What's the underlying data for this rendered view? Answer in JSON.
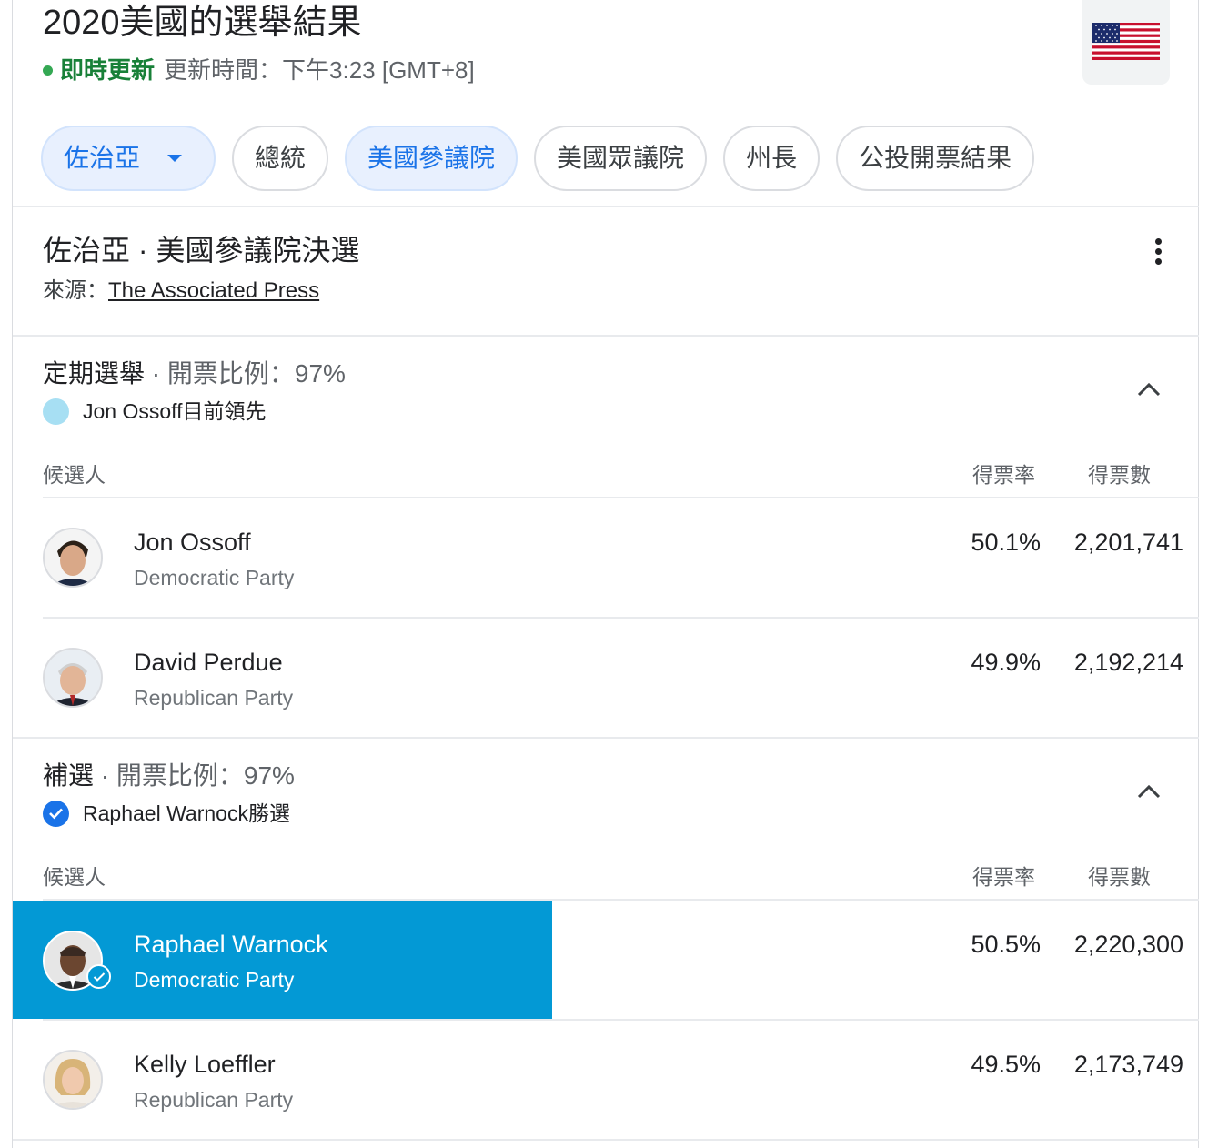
{
  "header": {
    "title": "2020美國的選舉結果",
    "live_label": "即時更新",
    "update_time": "更新時間：下午3:23 [GMT+8]",
    "flag_icon": "us-flag-icon"
  },
  "tabs": [
    {
      "label": "佐治亞",
      "selected": true,
      "dropdown": true
    },
    {
      "label": "總統",
      "selected": false
    },
    {
      "label": "美國參議院",
      "selected": true
    },
    {
      "label": "美國眾議院",
      "selected": false
    },
    {
      "label": "州長",
      "selected": false
    },
    {
      "label": "公投開票結果",
      "selected": false
    }
  ],
  "race": {
    "title": "佐治亞 · 美國參議院決選",
    "source_label": "來源：",
    "source_link": "The Associated Press"
  },
  "sections": [
    {
      "title": "定期選舉",
      "sep": " · ",
      "reporting": "開票比例：97%",
      "status": "Jon Ossoff目前領先",
      "status_icon": "lead-dot-icon",
      "columns": {
        "candidate": "候選人",
        "pct": "得票率",
        "votes": "得票數"
      },
      "candidates": [
        {
          "name": "Jon Ossoff",
          "party": "Democratic Party",
          "pct": "50.1%",
          "votes": "2,201,741"
        },
        {
          "name": "David Perdue",
          "party": "Republican Party",
          "pct": "49.9%",
          "votes": "2,192,214"
        }
      ]
    },
    {
      "title": "補選",
      "sep": " · ",
      "reporting": "開票比例：97%",
      "status": "Raphael Warnock勝選",
      "status_icon": "check-circle-icon",
      "columns": {
        "candidate": "候選人",
        "pct": "得票率",
        "votes": "得票數"
      },
      "candidates": [
        {
          "name": "Raphael Warnock",
          "party": "Democratic Party",
          "pct": "50.5%",
          "votes": "2,220,300",
          "winner": true
        },
        {
          "name": "Kelly Loeffler",
          "party": "Republican Party",
          "pct": "49.5%",
          "votes": "2,173,749"
        }
      ]
    }
  ],
  "colors": {
    "live_green": "#188038",
    "selected_chip_bg": "#e8f0fe",
    "selected_chip_text": "#1a73e8",
    "winner_bar": "#0399d5",
    "lead_dot": "#a7dff3"
  }
}
